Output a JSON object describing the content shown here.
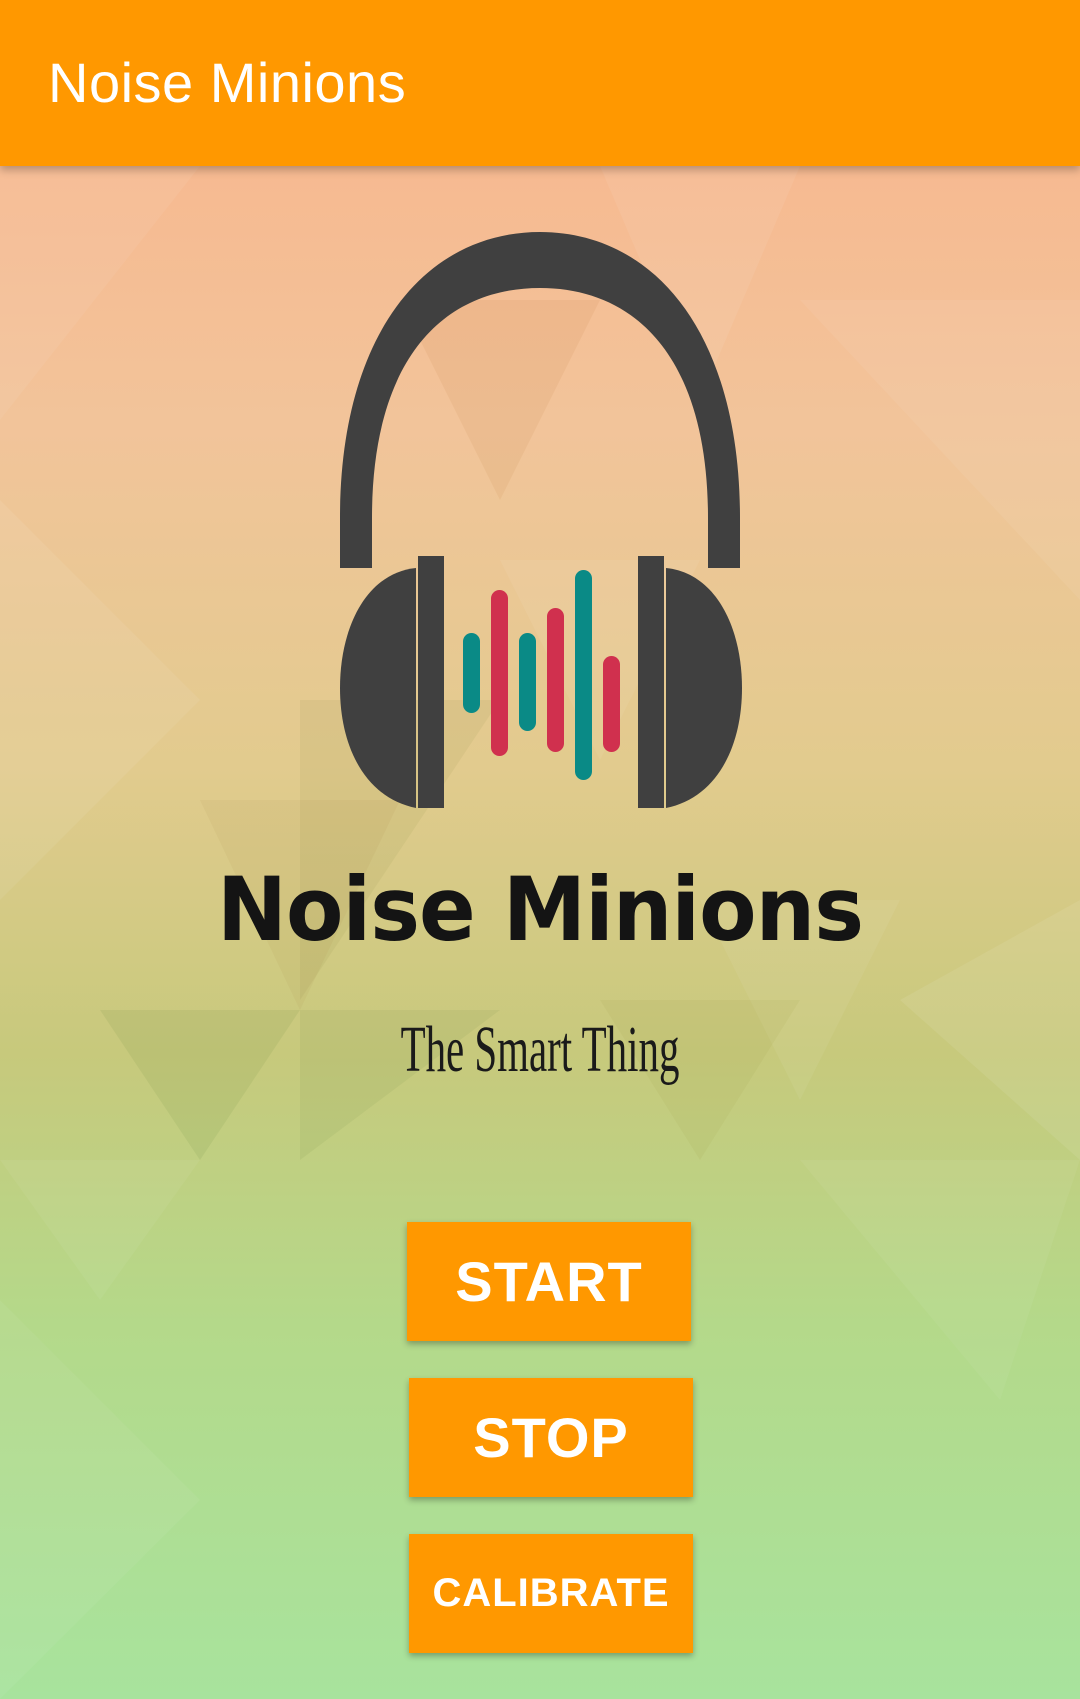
{
  "app_bar": {
    "title": "Noise Minions",
    "color": "#ff9800"
  },
  "logo": {
    "icon": "headphones-icon",
    "brand_name": "Noise Minions",
    "tagline": "The Smart Thing",
    "colors": {
      "headphones": "#404040",
      "wave_teal": "#0a8a86",
      "wave_red": "#d0304e"
    }
  },
  "buttons": {
    "start": "START",
    "stop": "STOP",
    "calibrate": "CALIBRATE"
  }
}
